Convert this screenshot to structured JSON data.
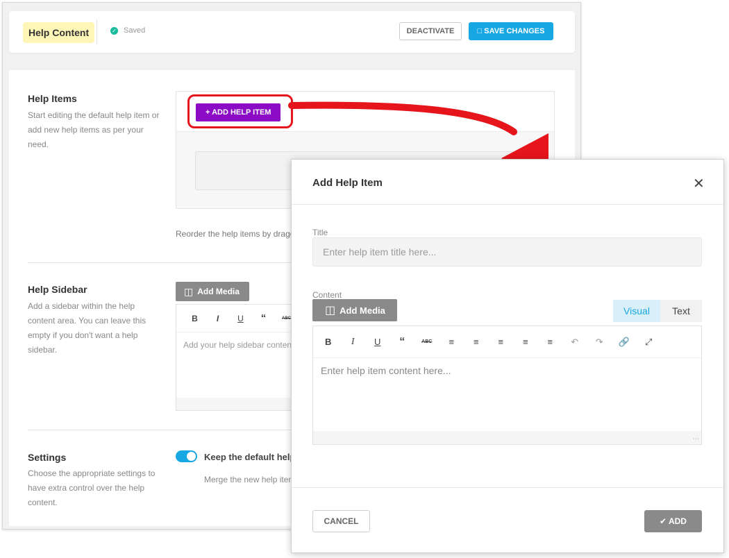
{
  "header": {
    "title": "Help Content",
    "saved_label": "Saved",
    "deactivate_label": "DEACTIVATE",
    "save_changes_label": "SAVE CHANGES"
  },
  "help_items": {
    "title": "Help Items",
    "description": "Start editing the default help item or add new help items as per your need.",
    "add_button_label": "ADD HELP ITEM",
    "reorder_hint": "Reorder the help items by draggi"
  },
  "help_sidebar": {
    "title": "Help Sidebar",
    "description": "Add a sidebar within the help content area. You can leave this empty if you don't want a help sidebar.",
    "add_media_label": "Add Media",
    "toolbar": [
      "B",
      "I",
      "U",
      "“",
      "ABC"
    ],
    "placeholder": "Add your help sidebar conten"
  },
  "settings": {
    "title": "Settings",
    "description": "Choose the appropriate settings to have extra control over the help content.",
    "toggle_label": "Keep the default help",
    "toggle_on": true,
    "toggle_description": "Merge the new help item"
  },
  "modal": {
    "title": "Add Help Item",
    "close_icon": "close-icon",
    "title_label": "Title",
    "title_placeholder": "Enter help item title here...",
    "content_label": "Content",
    "add_media_label": "Add Media",
    "tabs": {
      "visual": "Visual",
      "text": "Text",
      "active": "Visual"
    },
    "toolbar_icons": [
      "bold",
      "italic",
      "underline",
      "blockquote",
      "strikethrough",
      "bullet-list",
      "numbered-list",
      "align-left",
      "align-center",
      "align-right",
      "undo",
      "redo",
      "link",
      "fullscreen"
    ],
    "content_placeholder": "Enter help item content here...",
    "cancel_label": "CANCEL",
    "add_label": "ADD"
  },
  "colors": {
    "accent_blue": "#17a8e3",
    "purple_button": "#8b0cc4",
    "highlight_red": "#e6141b",
    "title_badge_bg": "#fdf6b7",
    "saved_green": "#1abc9c"
  }
}
